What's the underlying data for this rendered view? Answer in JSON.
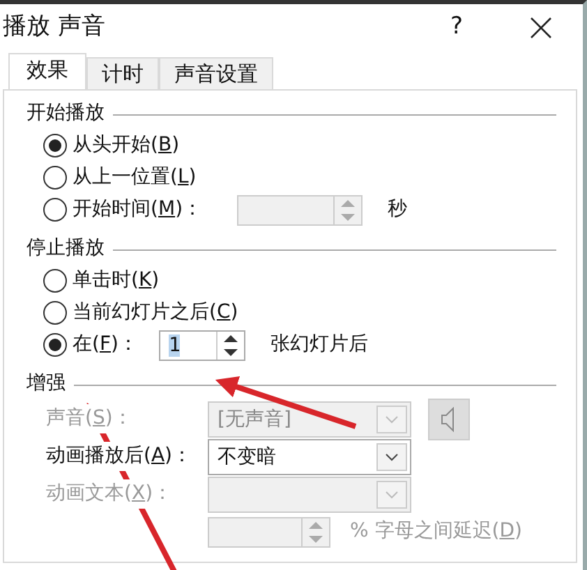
{
  "window": {
    "title": "播放 声音",
    "help": "?"
  },
  "tabs": [
    {
      "label": "效果",
      "selected": true
    },
    {
      "label": "计时",
      "selected": false
    },
    {
      "label": "声音设置",
      "selected": false
    }
  ],
  "start": {
    "heading": "开始播放",
    "options": [
      {
        "label": "从头开始(B)",
        "selected": true
      },
      {
        "label": "从上一位置(L)",
        "selected": false
      },
      {
        "label": "开始时间(M)：",
        "selected": false,
        "spin": {
          "disabled": true
        },
        "unit": "秒"
      }
    ]
  },
  "stop": {
    "heading": "停止播放",
    "options": [
      {
        "label": "单击时(K)",
        "selected": false
      },
      {
        "label": "当前幻灯片之后(C)",
        "selected": false
      },
      {
        "label": "在(F)：",
        "selected": true,
        "spin": {
          "value": "1",
          "disabled": false
        },
        "unit": "张幻灯片后"
      }
    ]
  },
  "enhance": {
    "heading": "增强",
    "rows": [
      {
        "kind": "combo",
        "label": "声音(S)：",
        "value": "[无声音]",
        "disabled": true,
        "speaker": true
      },
      {
        "kind": "combo",
        "label": "动画播放后(A)：",
        "value": "不变暗",
        "disabled": false
      },
      {
        "kind": "combo",
        "label": "动画文本(X)：",
        "disabled": true
      },
      {
        "kind": "spin",
        "disabled": true,
        "unit": "% 字母之间延迟(D)"
      }
    ]
  }
}
